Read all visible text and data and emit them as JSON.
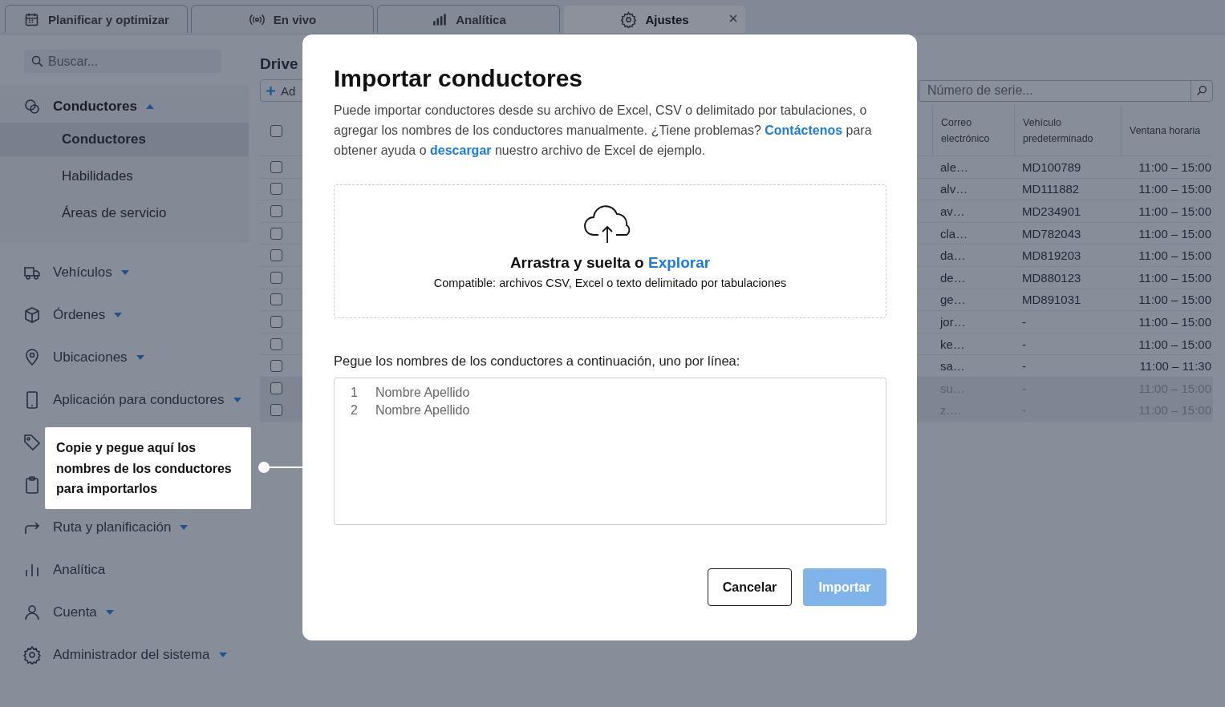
{
  "tabs": [
    {
      "kind": "calendar",
      "label": "Planificar y optimizar",
      "selected": false,
      "closable": false
    },
    {
      "kind": "live",
      "label": "En vivo",
      "selected": false,
      "closable": false
    },
    {
      "kind": "bars",
      "label": "Analítica",
      "selected": false,
      "closable": false
    },
    {
      "kind": "gear",
      "label": "Ajustes",
      "selected": true,
      "closable": true
    }
  ],
  "sidebar": {
    "search": {
      "placeholder": "Buscar..."
    },
    "items": [
      {
        "kind": "drivers",
        "label": "Conductores",
        "expanded": true,
        "children": [
          {
            "label": "Conductores",
            "selected": true
          },
          {
            "label": "Habilidades",
            "selected": false
          },
          {
            "label": "Áreas de servicio",
            "selected": false
          }
        ]
      },
      {
        "kind": "truck",
        "label": "Vehículos",
        "expanded": false
      },
      {
        "kind": "box",
        "label": "Órdenes",
        "expanded": false
      },
      {
        "kind": "pin",
        "label": "Ubicaciones",
        "expanded": false
      },
      {
        "kind": "phone",
        "label": "Aplicación para conductores",
        "expanded": false
      },
      {
        "kind": "tag"
      },
      {
        "kind": "clipboard"
      },
      {
        "kind": "route",
        "label": "Ruta y planificación",
        "expanded": false
      },
      {
        "kind": "chart",
        "label": "Analítica"
      },
      {
        "kind": "user",
        "label": "Cuenta",
        "expanded": false
      },
      {
        "kind": "gear",
        "label": "Administrador del sistema",
        "expanded": false
      }
    ]
  },
  "main": {
    "title": "Drive",
    "add_button": "Ad",
    "search": {
      "placeholder": "Número de serie..."
    },
    "table": {
      "select_all_checked": false,
      "columns": [
        "Correo electrónico",
        "Vehículo predeterminado",
        "Ventana horaria"
      ],
      "rows": [
        {
          "email": "ale…",
          "vehicle": "MD100789",
          "window": "11:00 – 15:00",
          "disabled": false,
          "checked": false
        },
        {
          "email": "alv…",
          "vehicle": "MD111882",
          "window": "11:00 – 15:00",
          "disabled": false,
          "checked": false
        },
        {
          "email": "av…",
          "vehicle": "MD234901",
          "window": "11:00 – 15:00",
          "disabled": false,
          "checked": false
        },
        {
          "email": "cla…",
          "vehicle": "MD782043",
          "window": "11:00 – 15:00",
          "disabled": false,
          "checked": false
        },
        {
          "email": "da…",
          "vehicle": "MD819203",
          "window": "11:00 – 15:00",
          "disabled": false,
          "checked": false
        },
        {
          "email": "de…",
          "vehicle": "MD880123",
          "window": "11:00 – 15:00",
          "disabled": false,
          "checked": false
        },
        {
          "email": "ge…",
          "vehicle": "MD891031",
          "window": "11:00 – 15:00",
          "disabled": false,
          "checked": false
        },
        {
          "email": "jor…",
          "vehicle": "-",
          "window": "11:00 – 15:00",
          "disabled": false,
          "checked": false
        },
        {
          "email": "ke…",
          "vehicle": "-",
          "window": "11:00 – 15:00",
          "disabled": false,
          "checked": false
        },
        {
          "email": "sa…",
          "vehicle": "-",
          "window": "11:00 – 11:30",
          "disabled": false,
          "checked": false
        },
        {
          "email": "su…",
          "vehicle": "-",
          "window": "11:00 – 15:00",
          "disabled": true,
          "checked": false
        },
        {
          "email": "z.…",
          "vehicle": "-",
          "window": "11:00 – 15:00",
          "disabled": true,
          "checked": false
        }
      ]
    }
  },
  "dialog": {
    "title": "Importar conductores",
    "description": [
      {
        "kind": "text",
        "text": "Puede importar conductores desde su archivo de Excel, CSV o delimitado por tabulaciones, o agregar los nombres de los conductores manualmente. ¿Tiene problemas? "
      },
      {
        "kind": "link",
        "text": "Contáctenos"
      },
      {
        "kind": "text",
        "text": " para obtener ayuda o "
      },
      {
        "kind": "link",
        "text": "descargar"
      },
      {
        "kind": "text",
        "text": " nuestro archivo de Excel de ejemplo."
      }
    ],
    "dropzone": {
      "prompt": "Arrastra y suelta o",
      "link": "Explorar",
      "hint": "Compatible: archivos CSV, Excel o texto delimitado por tabulaciones"
    },
    "paste_label": "Pegue los nombres de los conductores a continuación, uno por línea:",
    "editor_lines": [
      {
        "number": "1",
        "placeholder": "Nombre Apellido"
      },
      {
        "number": "2",
        "placeholder": "Nombre Apellido"
      }
    ],
    "buttons": [
      {
        "kind": "secondary",
        "label": "Cancelar",
        "disabled": false
      },
      {
        "kind": "primary",
        "label": "Importar",
        "disabled": true
      }
    ]
  },
  "callout": {
    "text": "Copie y pegue aquí los nombres de los conductores para importarlos"
  }
}
